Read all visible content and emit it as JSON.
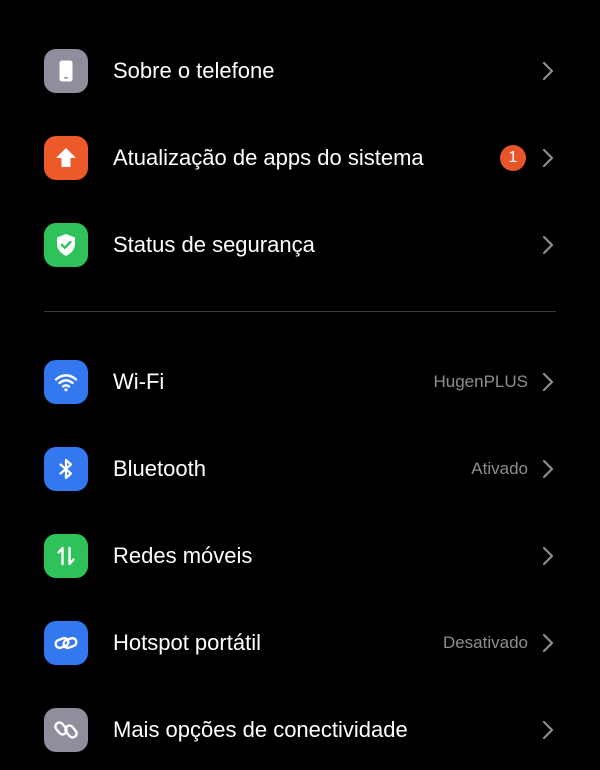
{
  "colors": {
    "background": "#000000",
    "text_primary": "#ffffff",
    "text_secondary": "#8d8d92",
    "divider": "#3a3a3c",
    "badge": "#e8552a"
  },
  "settings": {
    "group1": [
      {
        "label": "Sobre o telefone",
        "icon": "phone-icon",
        "icon_color": "#8e8e9c"
      },
      {
        "label": "Atualização de apps do sistema",
        "icon": "arrow-up-icon",
        "icon_color": "#ec5a2a",
        "badge": "1"
      },
      {
        "label": "Status de segurança",
        "icon": "shield-check-icon",
        "icon_color": "#2fc15a"
      }
    ],
    "group2": [
      {
        "label": "Wi-Fi",
        "value": "HugenPLUS",
        "icon": "wifi-icon",
        "icon_color": "#3478f0"
      },
      {
        "label": "Bluetooth",
        "value": "Ativado",
        "icon": "bluetooth-icon",
        "icon_color": "#3478f0"
      },
      {
        "label": "Redes móveis",
        "icon": "mobile-data-icon",
        "icon_color": "#2fc15a"
      },
      {
        "label": "Hotspot portátil",
        "value": "Desativado",
        "icon": "hotspot-link-icon",
        "icon_color": "#3478f0"
      },
      {
        "label": "Mais opções de conectividade",
        "icon": "link-icon",
        "icon_color": "#8e8e9c"
      }
    ]
  }
}
